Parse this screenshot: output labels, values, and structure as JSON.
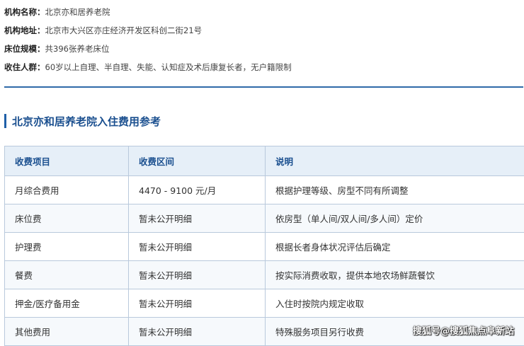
{
  "info": [
    {
      "label": "机构名称：",
      "value": "北京亦和居养老院"
    },
    {
      "label": "机构地址：",
      "value": "北京市大兴区亦庄经济开发区科创二街21号"
    },
    {
      "label": "床位规模：",
      "value": "共396张养老床位"
    },
    {
      "label": "收住人群：",
      "value": "60岁以上自理、半自理、失能、认知症及术后康复长者，无户籍限制"
    }
  ],
  "section": {
    "title": "北京亦和居养老院入住费用参考"
  },
  "table": {
    "headers": [
      "收费项目",
      "收费区间",
      "说明"
    ],
    "rows": [
      [
        "月综合费用",
        "4470 - 9100 元/月",
        "根据护理等级、房型不同有所调整"
      ],
      [
        "床位费",
        "暂未公开明细",
        "依房型（单人间/双人间/多人间）定价"
      ],
      [
        "护理费",
        "暂未公开明细",
        "根据长者身体状况评估后确定"
      ],
      [
        "餐费",
        "暂未公开明细",
        "按实际消费收取，提供本地农场鲜蔬餐饮"
      ],
      [
        "押金/医疗备用金",
        "暂未公开明细",
        "入住时按院内规定收取"
      ],
      [
        "其他费用",
        "暂未公开明细",
        "特殊服务项目另行收费"
      ]
    ]
  },
  "watermark": "搜狐号@搜狐焦点阜新站",
  "colors": {
    "accent": "#1f5fa8",
    "header_bg": "#e6eff8",
    "border": "#b9c9dc"
  }
}
